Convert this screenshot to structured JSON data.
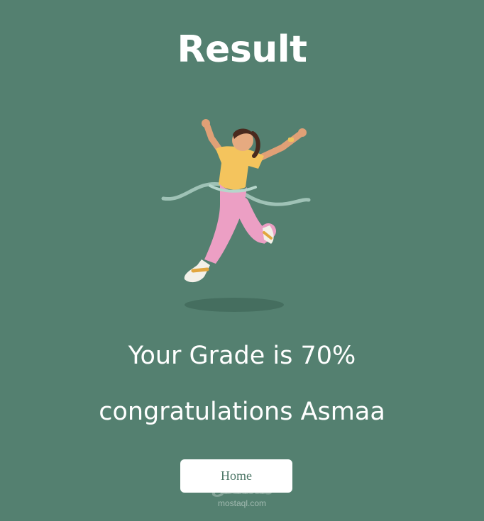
{
  "page": {
    "title": "Result",
    "grade_text": "Your Grade is 70%",
    "congrats_text": "congratulations Asmaa",
    "home_button_label": "Home"
  },
  "watermark": {
    "arabic": "مستقل",
    "site": "mostaql.com"
  },
  "colors": {
    "background": "#548070",
    "text": "#ffffff",
    "button_bg": "#ffffff",
    "button_text": "#4b7565"
  }
}
